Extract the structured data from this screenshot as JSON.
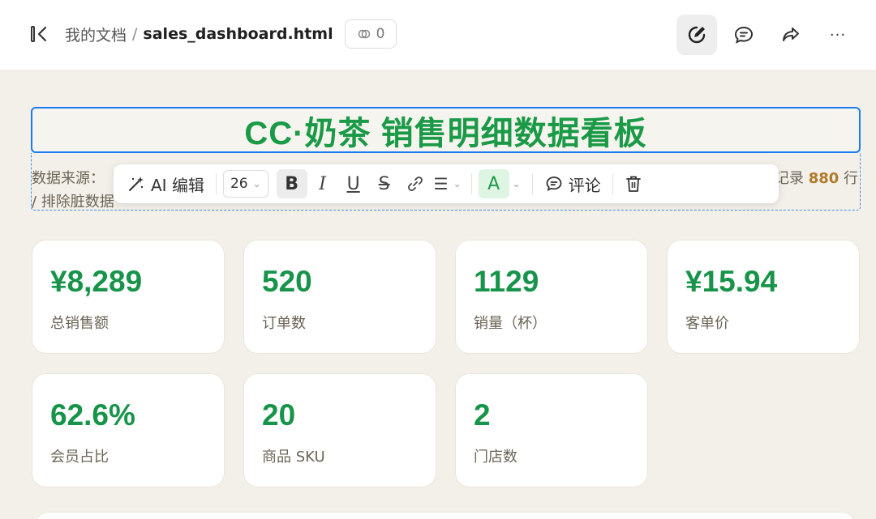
{
  "topbar": {
    "breadcrumb_root": "我的文档",
    "breadcrumb_sep": "/",
    "file_name": "sales_dashboard.html",
    "link_count": "0",
    "more_label": "···"
  },
  "title": "CC·奶茶 销售明细数据看板",
  "meta": {
    "line1_left": "数据来源：",
    "line1_right_prefix": "记录",
    "line1_right_count": "880",
    "line1_right_suffix": "行",
    "line2": "/ 排除脏数据"
  },
  "toolbar": {
    "ai_label": "AI 编辑",
    "font_size": "26",
    "bold": "B",
    "italic": "I",
    "underline": "U",
    "strike": "S",
    "align": "☰",
    "color": "A",
    "comment_label": "评论"
  },
  "stats": [
    {
      "value": "¥8,289",
      "label": "总销售额"
    },
    {
      "value": "520",
      "label": "订单数"
    },
    {
      "value": "1129",
      "label": "销量（杯）"
    },
    {
      "value": "¥15.94",
      "label": "客单价"
    },
    {
      "value": "62.6%",
      "label": "会员占比"
    },
    {
      "value": "20",
      "label": "商品 SKU"
    },
    {
      "value": "2",
      "label": "门店数"
    }
  ],
  "colors": {
    "accent_green": "#18944a",
    "selection_blue": "#1a7cf0",
    "highlight_amber": "#b07a2a"
  }
}
